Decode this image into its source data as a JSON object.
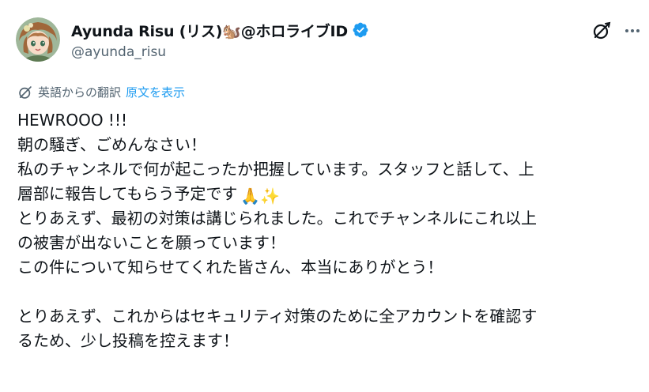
{
  "author": {
    "display_name": "Ayunda Risu (リス)🐿️@ホロライブID",
    "handle": "@ayunda_risu",
    "verified_icon": "verified-badge-icon"
  },
  "actions": {
    "grok_icon": "grok-icon",
    "more_icon": "more-icon"
  },
  "translation": {
    "label": "英語からの翻訳",
    "show_original": "原文を表示"
  },
  "body": {
    "line1": "HEWROOO !!!",
    "line2": "朝の騒ぎ、ごめんなさい！",
    "line3": "私のチャンネルで何が起こったか把握しています。スタッフと話して、上",
    "line4": "層部に報告してもらう予定です",
    "line4_emojis": "🙏✨",
    "line5": "とりあえず、最初の対策は講じられました。これでチャンネルにこれ以上",
    "line6": "の被害が出ないことを願っています！",
    "line7": "この件について知らせてくれた皆さん、本当にありがとう！",
    "line8": "",
    "line9": "とりあえず、これからはセキュリティ対策のために全アカウントを確認す",
    "line10": "るため、少し投稿を控えます！"
  },
  "colors": {
    "text": "#0f1419",
    "secondary": "#536471",
    "link": "#1d9bf0",
    "verified": "#1d9bf0"
  }
}
